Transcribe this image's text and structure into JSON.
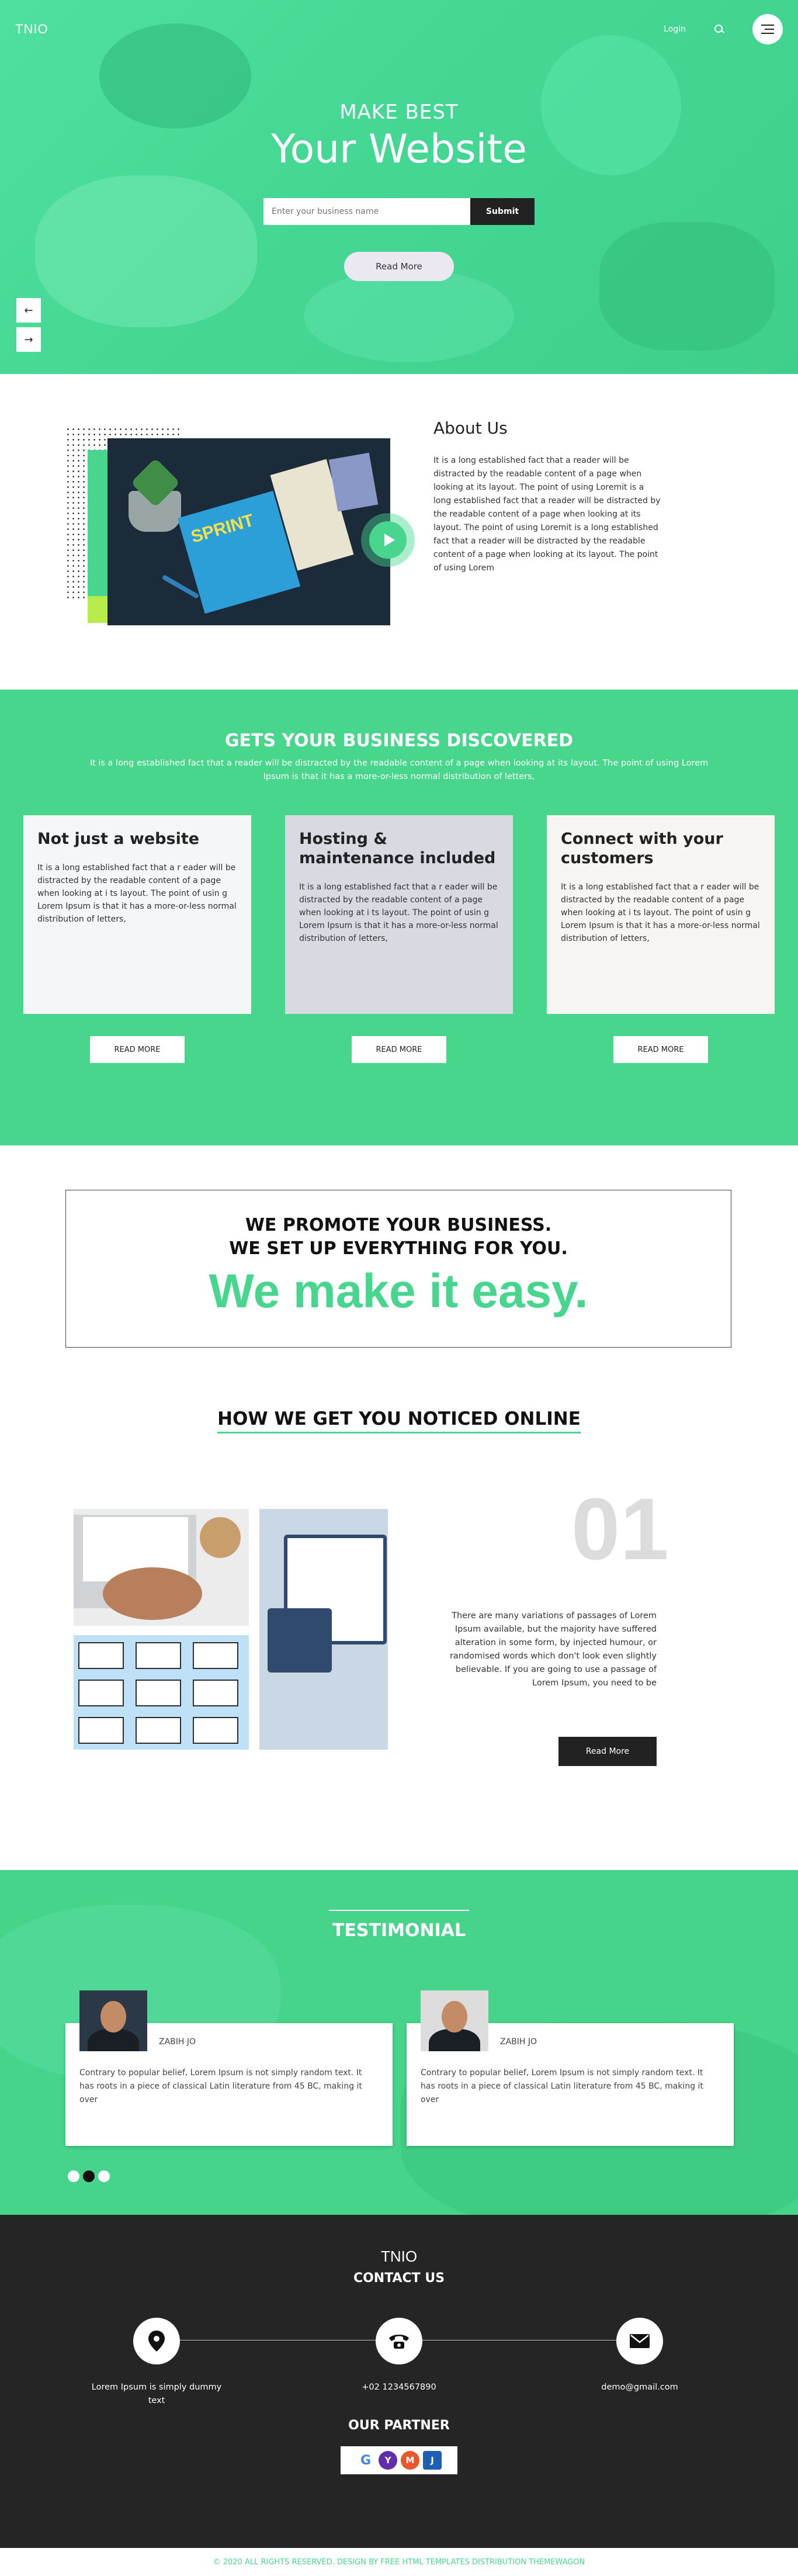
{
  "header": {
    "logo": "TNIO",
    "login": "Login"
  },
  "hero": {
    "kicker": "MAKE BEST",
    "title": "Your Website",
    "input_placeholder": "Enter your business name",
    "submit": "Submit",
    "read_more": "Read More",
    "prev_arrow": "←",
    "next_arrow": "→"
  },
  "about": {
    "title": "About Us",
    "body": "It is a long established fact that a reader will be distracted by the readable content of a page when looking at its layout. The point of using Loremit is a long established fact that a reader will be distracted by the readable content of a page when looking at its layout. The point of using Loremit is a long established fact that a reader will be distracted by the readable content of a page when looking at its layout. The point of using Lorem",
    "book_label": "SPRINT"
  },
  "services": {
    "title": "GETS YOUR BUSINESS DISCOVERED",
    "subtitle": "It is a long established fact that a reader will be distracted by the readable content of a page when looking at its layout. The point of using Lorem Ipsum is that it has a more-or-less normal distribution of letters,",
    "cards": [
      {
        "title": "Not just a website",
        "body": "It is a long established fact that a r eader will be distracted by the readable content of a page when looking at i ts layout. The point of usin g Lorem Ipsum is that it has a more-or-less normal distribution of letters,",
        "button": "READ MORE",
        "bg": "#cfd6dd"
      },
      {
        "title": "Hosting & maintenance included",
        "body": "It is a long established fact that a r eader will be distracted by the readable content of a page when looking at i ts layout. The point of usin g Lorem Ipsum is that it has a more-or-less normal distribution of letters,",
        "button": "READ MORE",
        "bg": "#4a5d79"
      },
      {
        "title": "Connect with your customers",
        "body": "It is a long established fact that a r eader will be distracted by the readable content of a page when looking at i ts layout. The point of usin g Lorem Ipsum is that it has a more-or-less normal distribution of letters,",
        "button": "READ MORE",
        "bg": "#d8cfc4"
      }
    ]
  },
  "promote": {
    "line1": "WE PROMOTE YOUR BUSINESS.",
    "line2": "WE SET UP EVERYTHING FOR YOU.",
    "line3": "We make it easy."
  },
  "noticed": {
    "title": "HOW WE GET YOU NOTICED ONLINE",
    "number": "01",
    "body": "There are many variations of passages of Lorem Ipsum available, but the majority have suffered alteration in some form, by injected humour, or randomised words which don't look even slightly believable. If you are going to use a passage of Lorem Ipsum, you need to be",
    "button": "Read More"
  },
  "testimonial": {
    "title": "TESTIMONIAL",
    "items": [
      {
        "name": "ZABIH JO",
        "quote": "Contrary to popular belief, Lorem Ipsum is not simply random text. It has roots in a piece of classical Latin literature from 45 BC, making it over"
      },
      {
        "name": "ZABIH JO",
        "quote": "Contrary to popular belief, Lorem Ipsum is not simply random text. It has roots in a piece of classical Latin literature from 45 BC, making it over"
      }
    ],
    "active_dot": 1,
    "dot_count": 3
  },
  "footer": {
    "logo": "TNIO",
    "contact_title": "CONTACT US",
    "address": "Lorem Ipsum is simply dummy text",
    "phone": "+02 1234567890",
    "email": "demo@gmail.com",
    "partner_title": "OUR PARTNER",
    "partners": [
      "G",
      "Y",
      "M",
      "J"
    ],
    "copyright": "© 2020 ALL RIGHTS RESERVED. DESIGN BY FREE HTML TEMPLATES DISTRIBUTION THEMEWAGON"
  },
  "colors": {
    "accent": "#48d68e",
    "lime": "#b7ec4d",
    "dark": "#252525"
  }
}
